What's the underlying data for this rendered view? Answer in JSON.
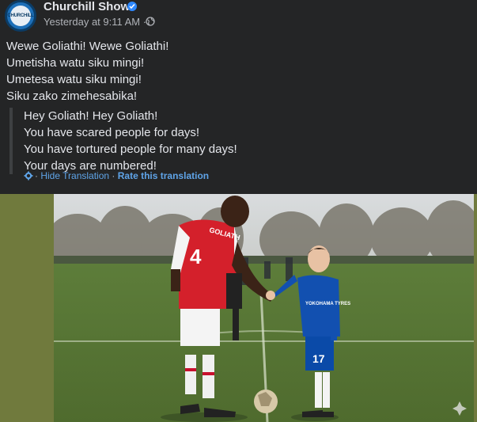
{
  "post": {
    "page_name": "Churchill Show",
    "timestamp": "Yesterday at 9:11 AM",
    "avatar_text": "CHURCHILL",
    "lines": [
      "Wewe Goliathi! Wewe Goliathi!",
      "Umetisha watu siku mingi!",
      "Umetesa watu siku mingi!",
      "Siku zako zimehesabika!"
    ],
    "translation": [
      "Hey Goliath! Hey Goliath!",
      "You have scared people for days!",
      "You have tortured people for many days!",
      "Your days are numbered!"
    ],
    "hide_translation": "Hide Translation",
    "rate_translation": "Rate this translation"
  },
  "photo": {
    "left_player_number": "4",
    "left_player_name": "GOLIATH",
    "right_player_number": "17",
    "right_player_sponsor": "YOKOHAMA TYRES"
  },
  "colors": {
    "background": "#242526",
    "text": "#e4e6eb",
    "secondary": "#b0b3b8",
    "link": "#5fa4e8",
    "verified": "#2d88ff"
  }
}
